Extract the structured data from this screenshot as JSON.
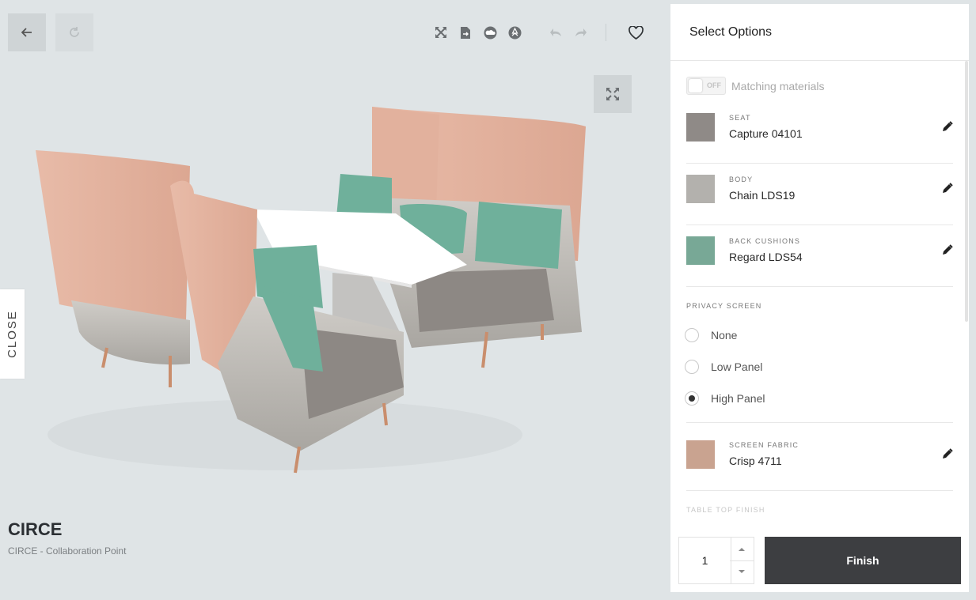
{
  "viewer": {
    "product_title": "CIRCE",
    "product_subtitle": "CIRCE - Collaboration Point",
    "close_label": "CLOSE"
  },
  "panel": {
    "title": "Select Options",
    "matching": {
      "state": "OFF",
      "label": "Matching materials"
    },
    "options": [
      {
        "category": "SEAT",
        "value": "Capture 04101",
        "color": "#8f8a87"
      },
      {
        "category": "BODY",
        "value": "Chain LDS19",
        "color": "#b3b1ad"
      },
      {
        "category": "BACK CUSHIONS",
        "value": "Regard LDS54",
        "color": "#78a896"
      }
    ],
    "privacy": {
      "title": "PRIVACY SCREEN",
      "choices": [
        "None",
        "Low Panel",
        "High Panel"
      ],
      "selected": "High Panel"
    },
    "screen_fabric": {
      "category": "SCREEN FABRIC",
      "value": "Crisp 4711",
      "color": "#c9a390"
    },
    "table_top_title": "TABLE TOP FINISH",
    "quantity": "1",
    "finish_label": "Finish"
  },
  "colors": {
    "background": "#dfe4e6",
    "finish_button": "#3d3e41",
    "panel_fabric": "#e3b3a0",
    "cushion": "#6fb09b",
    "chair_body": "#bdbab5"
  }
}
